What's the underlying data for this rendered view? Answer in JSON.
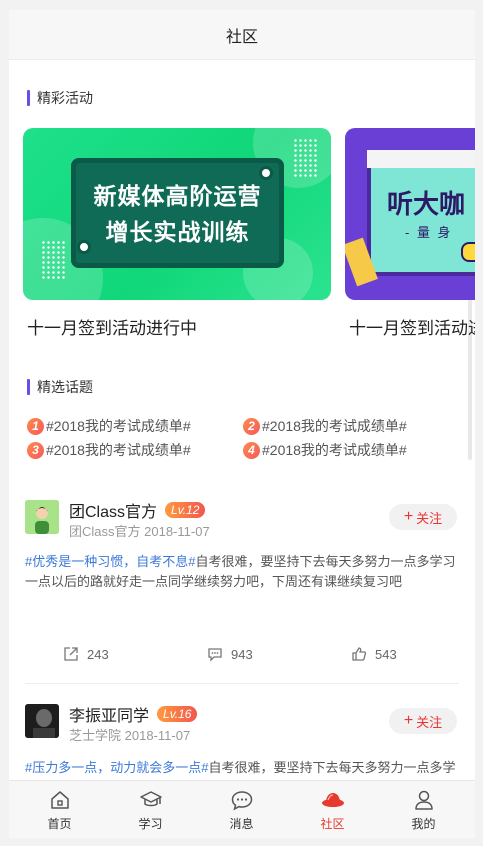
{
  "header": {
    "title": "社区"
  },
  "activities": {
    "section_title": "精彩活动",
    "banners": [
      {
        "line1": "新媒体高阶运营",
        "line2": "增长实战训练",
        "caption": "十一月签到活动进行中"
      },
      {
        "line1": "听大咖",
        "line2": "- 量 身",
        "caption": "十一月签到活动进行中"
      }
    ]
  },
  "topics": {
    "section_title": "精选话题",
    "items": [
      {
        "num": "1",
        "text": "#2018我的考试成绩单#"
      },
      {
        "num": "2",
        "text": "#2018我的考试成绩单#"
      },
      {
        "num": "3",
        "text": "#2018我的考试成绩单#"
      },
      {
        "num": "4",
        "text": "#2018我的考试成绩单#"
      }
    ]
  },
  "posts": [
    {
      "user": "团Class官方",
      "level": "Lv.12",
      "source": "团Class官方",
      "date": "2018-11-07",
      "follow": "关注",
      "tag": "#优秀是一种习惯，自考不息#",
      "body": "自考很难，要坚持下去每天多努力一点多学习一点以后的路就好走一点同学继续努力吧，下周还有课继续复习吧",
      "share": "243",
      "comments": "943",
      "likes": "543"
    },
    {
      "user": "李振亚同学",
      "level": "Lv.16",
      "source": "芝士学院",
      "date": "2018-11-07",
      "follow": "关注",
      "tag": "#压力多一点，动力就会多一点#",
      "body": "自考很难，要坚持下去每天多努力一点多学习一点以后的路就好走一点同学继续努力吧，下周还有课继续复习吧"
    }
  ],
  "tabbar": {
    "items": [
      {
        "label": "首页",
        "icon": "home-icon"
      },
      {
        "label": "学习",
        "icon": "graduation-cap-icon"
      },
      {
        "label": "消息",
        "icon": "chat-bubble-icon"
      },
      {
        "label": "社区",
        "icon": "community-icon",
        "active": true
      },
      {
        "label": "我的",
        "icon": "user-icon"
      }
    ]
  },
  "colors": {
    "accent": "#6b4ce6",
    "active_tab": "#e63a2e",
    "hashtag": "#3b78d8",
    "follow": "#ee3333"
  }
}
